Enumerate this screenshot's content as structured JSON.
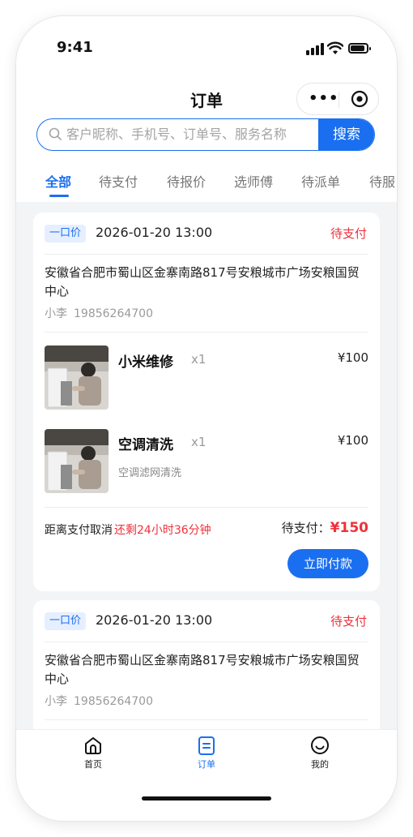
{
  "status_bar": {
    "time": "9:41"
  },
  "header": {
    "title": "订单",
    "more_icon": "more-dots-icon",
    "close_icon": "target-circle-icon"
  },
  "search": {
    "placeholder": "客户昵称、手机号、订单号、服务名称",
    "button_label": "搜索"
  },
  "tabs": [
    {
      "label": "全部",
      "active": true
    },
    {
      "label": "待支付"
    },
    {
      "label": "待报价"
    },
    {
      "label": "选师傅"
    },
    {
      "label": "待派单"
    },
    {
      "label": "待服"
    }
  ],
  "orders": [
    {
      "tag": "一口价",
      "time": "2026-01-20 13:00",
      "status": "待支付",
      "address": "安徽省合肥市蜀山区金寨南路817号安粮城市广场安粮国贸中心",
      "contact_name": "小李",
      "contact_phone": "19856264700",
      "items": [
        {
          "name": "小米维修",
          "qty": "x1",
          "price": "¥100",
          "sub": ""
        },
        {
          "name": "空调清洗",
          "qty": "x1",
          "price": "¥100",
          "sub": "空调滤网清洗"
        }
      ],
      "cancel_prefix": "距离支付取消",
      "cancel_remaining": "还剩24小时36分钟",
      "pay_label": "待支付：",
      "pay_amount": "¥150",
      "pay_button": "立即付款"
    },
    {
      "tag": "一口价",
      "time": "2026-01-20 13:00",
      "status": "待支付",
      "address": "安徽省合肥市蜀山区金寨南路817号安粮城市广场安粮国贸中心",
      "contact_name": "小李",
      "contact_phone": "19856264700"
    }
  ],
  "tabbar": [
    {
      "label": "首页",
      "icon": "home-icon"
    },
    {
      "label": "订单",
      "icon": "order-icon",
      "active": true
    },
    {
      "label": "我的",
      "icon": "smile-icon"
    }
  ],
  "colors": {
    "primary": "#1a6ff0",
    "danger": "#f0303a",
    "background": "#f3f4f6"
  }
}
